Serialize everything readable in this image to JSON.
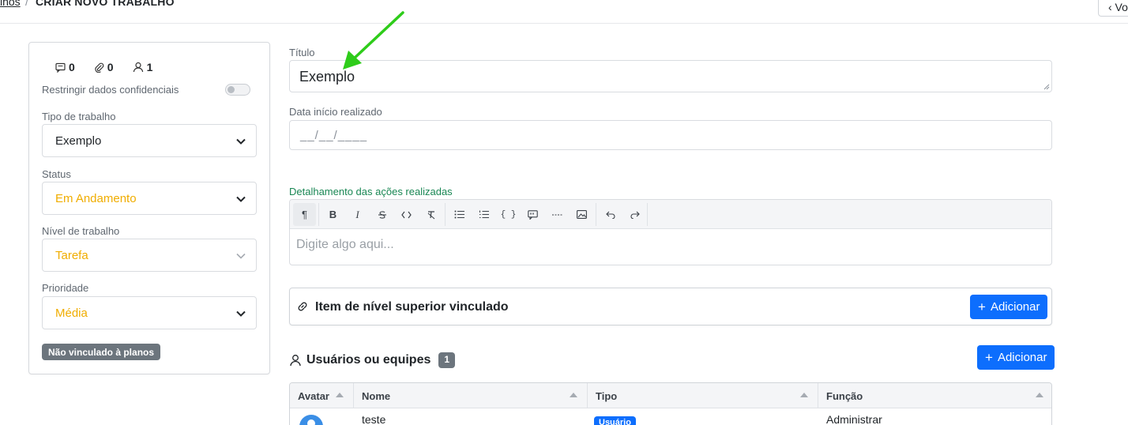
{
  "breadcrumb": {
    "parent": "lhos",
    "separator": "/",
    "current": "CRIAR NOVO TRABALHO"
  },
  "back_button": {
    "label": "‹  Vo"
  },
  "sidebar": {
    "counters": {
      "comments": "0",
      "attachments": "0",
      "users": "1"
    },
    "confidential_label": "Restringir dados confidenciais",
    "work_type": {
      "label": "Tipo de trabalho",
      "value": "Exemplo"
    },
    "status": {
      "label": "Status",
      "value": "Em Andamento"
    },
    "level": {
      "label": "Nível de trabalho",
      "value": "Tarefa"
    },
    "priority": {
      "label": "Prioridade",
      "value": "Média"
    },
    "plan_badge": "Não vinculado à planos"
  },
  "form": {
    "title_label": "Título",
    "title_value": "Exemplo",
    "date_label": "Data início realizado",
    "date_placeholder": "__/__/____",
    "details_label": "Detalhamento das ações realizadas",
    "editor_placeholder": "Digite algo aqui...",
    "toolbar_icons": [
      "paragraph-icon",
      "bold-icon",
      "italic-icon",
      "strikethrough-icon",
      "code-icon",
      "clear-format-icon",
      "bullet-list-icon",
      "ordered-list-icon",
      "code-block-icon",
      "quote-icon",
      "horizontal-rule-icon",
      "image-icon",
      "undo-icon",
      "redo-icon"
    ],
    "toolbar_glyphs": {
      "paragraph": "¶",
      "bold": "B",
      "italic": "I",
      "code_block": "{ }"
    }
  },
  "linked_item": {
    "title": "Item de nível superior vinculado",
    "add_label": "Adicionar"
  },
  "users": {
    "title": "Usuários ou equipes",
    "count": "1",
    "add_label": "Adicionar",
    "columns": [
      "Avatar",
      "Nome",
      "Tipo",
      "Função"
    ],
    "rows": [
      {
        "name": "teste",
        "type": "Usuário",
        "role": "Administrar"
      }
    ]
  },
  "colors": {
    "primary": "#0d6efd",
    "warning_text": "#f0ad00",
    "success_label": "#198754",
    "annotation_arrow": "#2ecc1a"
  }
}
